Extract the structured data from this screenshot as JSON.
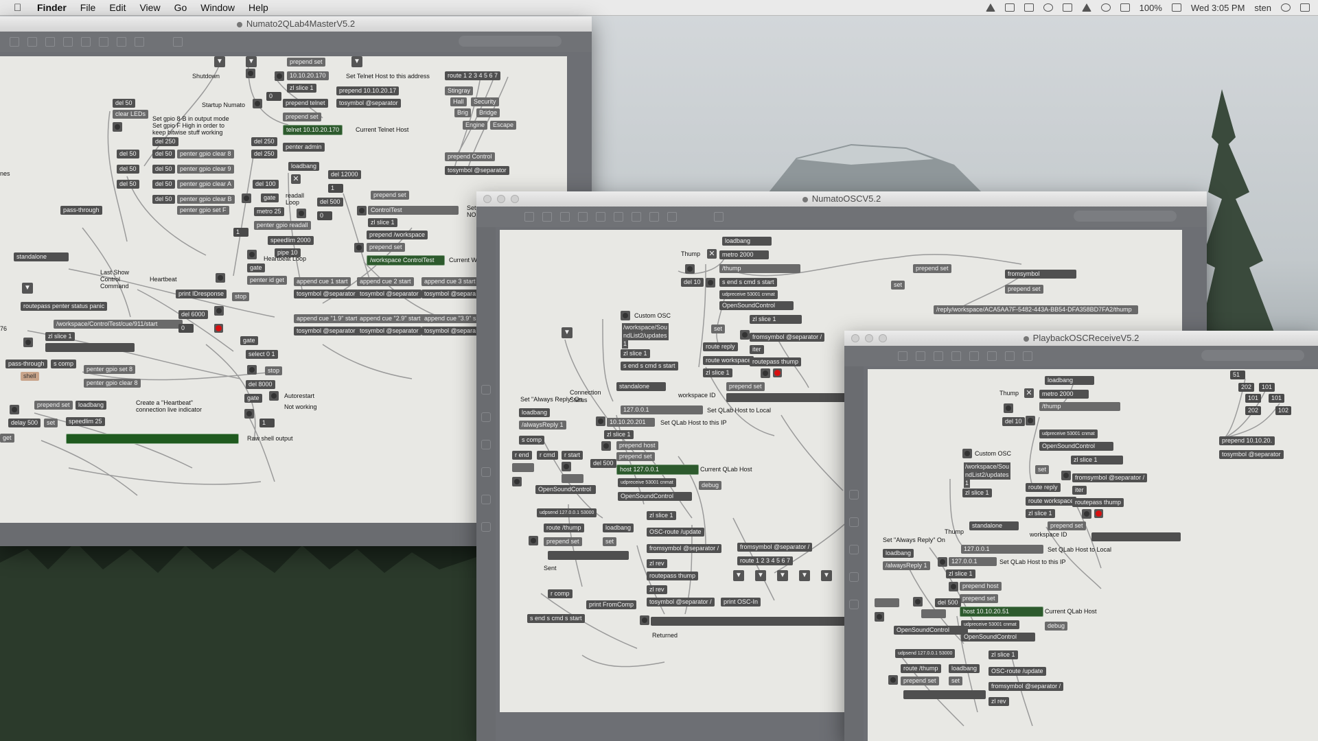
{
  "menubar": {
    "app": "Finder",
    "items": [
      "File",
      "Edit",
      "View",
      "Go",
      "Window",
      "Help"
    ],
    "battery": "100%",
    "clock": "Wed 3:05 PM",
    "user": "sten",
    "status_icons": [
      "cloud-icon",
      "dropbox-icon",
      "display-icon",
      "notification-icon",
      "bluetooth-icon",
      "volume-icon",
      "wifi-icon",
      "keyboard-icon",
      "battery-icon",
      "search-icon",
      "menu-icon"
    ]
  },
  "window1": {
    "title": "Numato2QLab4MasterV5.2",
    "objects": {
      "prepend_set_top": "prepend set",
      "ip_170": "10.10.20.170",
      "set_telnet_comment": "Set Telnet Host to this address",
      "route_1_7": "route 1 2 3 4 5 6 7",
      "shutdown": "Shutdown",
      "zl_slice_1": "zl slice 1",
      "prepend_ip_17": "prepend 10.10.20.17",
      "stingray": "Stingray",
      "del_50": "del 50",
      "startup_numato": "Startup Numato",
      "prepend_telnet": "prepend telnet",
      "tosymbol_sep": "tosymbol @separator",
      "hall": "Hall",
      "security": "Security",
      "clear_leds": "clear LEDs",
      "brig": "Brig",
      "bridge": "Bridge",
      "gpio_comment_1": "Set gpio 8-B in output mode",
      "gpio_comment_2": "Set gpio F High in order to",
      "gpio_comment_3": "keep bitwise stuff working",
      "prepend_set_2": "prepend set",
      "engine": "Engine",
      "escape": "Escape",
      "telnet_170": "telnet 10.10.20.170",
      "current_telnet_host": "Current Telnet Host",
      "del_250": "del 250",
      "penter_gpio_clear_8": "penter gpio clear 8",
      "penter_gpio_clear_9": "penter gpio clear 9",
      "penter_gpio_clear_a": "penter gpio clear A",
      "penter_gpio_clear_b": "penter gpio clear B",
      "penter_gpio_set_f": "penter gpio set F",
      "penter_admin": "penter admin",
      "prepend_control": "prepend Control",
      "tosymbol_sep_2": "tosymbol @separator",
      "loadbang": "loadbang",
      "del_12000": "del 12000",
      "del_100": "del 100",
      "gate": "gate",
      "readall_loop": "readall",
      "loop": "Loop",
      "metro_25": "metro 25",
      "del_500": "del 500",
      "control_test": "ControlTest",
      "pass_through": "pass-through",
      "penter_gpio_readall": "penter gpio readall",
      "speedlim_2000": "speedlim 2000",
      "prepend_workspace": "prepend /workspace",
      "pipe_10": "pipe 10",
      "heartbeat_loop": "Heartbeat Loop",
      "workspace_controltest": "/workspace ControlTest",
      "current_w": "Current W",
      "standalone": "standalone",
      "penter_id_get": "penter id get",
      "append_cue_1": "append cue 1 start",
      "append_cue_2": "append cue 2 start",
      "append_cue_3": "append cue 3 start",
      "last_show_1": "Last Show",
      "last_show_2": "Control",
      "last_show_3": "Command",
      "heartbeat": "Heartbeat",
      "print_idresponse": "print IDresponse",
      "stop": "stop",
      "tosymbol_a": "tosymbol @separator",
      "tosymbol_b": "tosymbol @separator",
      "tosymbol_c": "tosymbol @separa",
      "routepass_penter": "routepass penter status panic",
      "del_6000": "del 6000",
      "append_cue_19": "append cue \"1.9\" start",
      "append_cue_29": "append cue \"2.9\" start",
      "append_cue_39": "append cue \"3.9\" s",
      "workspace_cue_path": "/workspace/ControlTest/cue/911/start",
      "zl_slice_1b": "zl slice 1",
      "select_0_1": "select 0 1",
      "pass_through_2": "pass-through",
      "s_comp": "s comp",
      "penter_gpio_set_8": "penter gpio set 8",
      "shell": "shell",
      "penter_gpio_clear_8b": "penter gpio clear 8",
      "del_8000": "del 8000",
      "autorestart": "Autorestart",
      "not_working": "Not working",
      "prepend_set_3": "prepend set",
      "loadbang_2": "loadbang",
      "heartbeat_comment_1": "Create a \"Heartbeat\"",
      "heartbeat_comment_2": "connection live indicator",
      "delay_500": "delay 500",
      "set": "set",
      "speedlim_25": "speedlim 25",
      "raw_shell_output": "Raw shell output",
      "get": "get",
      "nes": "nes",
      "n76": "76",
      "n0": "0",
      "n1": "1",
      "x": "✕",
      "sn": "Set",
      "no": "NO"
    }
  },
  "window2": {
    "title": "NumatoOSCV5.2",
    "objects": {
      "loadbang": "loadbang",
      "thump": "Thump",
      "metro_2000": "metro 2000",
      "thump_path": "/thump",
      "prepend_set": "prepend set",
      "fromsymbol": "fromsymbol",
      "del_10": "del 10",
      "s_end_cmd_start": "s end  s cmd  s start",
      "set": "set",
      "prepend_set_2": "prepend set",
      "udpreceive": "udpreceive 53001 cnmat",
      "custom_osc": "Custom OSC",
      "open_sound_control": "OpenSoundControl",
      "reply_path": "/reply/workspace/ACA5AA7F-5482-443A-BB54-DFA358BD7FA2/thump",
      "workspace_path_1": "/workspace/Sou",
      "workspace_path_2": "ndList2/updates",
      "workspace_path_3": "1",
      "zl_slice_1": "zl slice 1",
      "set_2": "set",
      "fromsymbol_sep": "fromsymbol @separator /",
      "route_reply": "route reply",
      "iter": "iter",
      "route_workspace": "route workspace",
      "routepass_thump": "routepass thump",
      "zl_slice_1b": "zl slice 1",
      "standalone": "standalone",
      "prepend_set_3": "prepend set",
      "set_always_reply": "Set \"Always Reply\" On",
      "connection_status": "Connection Status",
      "workspace_id": "workspace ID",
      "loadbang_2": "loadbang",
      "localhost": "127.0.0.1",
      "set_qlab_local": "Set QLab Host to Local",
      "always_reply": "/alwaysReply 1",
      "ip_201": "10.10.20.201",
      "set_qlab_ip": "Set QLab Host to this IP",
      "zl_slice_1c": "zl slice 1",
      "s_comp": "s comp",
      "prepend_host": "prepend host",
      "r_end": "r end",
      "r_cmd": "r cmd",
      "r_start": "r start",
      "prepend_set_4": "prepend set",
      "del_500": "del 500",
      "host_local": "host 127.0.0.1",
      "current_qlab_host": "Current QLab Host",
      "udpreceive_2": "udpreceive 53001 cnmat",
      "open_sound_control_2": "OpenSoundControl",
      "open_sound_control_3": "OpenSoundControl",
      "debug": "debug",
      "udpsend": "udpsend 127.0.0.1 53000",
      "zl_slice_1d": "zl slice 1",
      "route_thump": "route /thump",
      "loadbang_3": "loadbang",
      "osc_route_update": "OSC-route /update",
      "prepend_set_5": "prepend set",
      "set_3": "set",
      "fromsymbol_sep_2": "fromsymbol @separator /",
      "fromsymbol_sep_3": "fromsymbol @separator /",
      "zl_rev": "zl rev",
      "route_1_7": "route 1 2 3 4 5 6 7",
      "sent": "Sent",
      "routepass_thump_2": "routepass thump",
      "zl_rev_2": "zl rev",
      "r_comp": "r comp",
      "tosymbol_sep": "tosymbol @separator /",
      "print_osc_in": "print OSC-In",
      "print_from_comp": "print FromComp",
      "s_end_2": "s end  s cmd  s start",
      "returned": "Returned",
      "x": "✕",
      "down": "▼"
    }
  },
  "window3": {
    "title": "PlaybackOSCReceiveV5.2",
    "objects": {
      "loadbang": "loadbang",
      "n51": "51",
      "n202": "202",
      "n101": "101",
      "n101b": "101",
      "n101c": "101",
      "n202b": "202",
      "n102": "102",
      "thump": "Thump",
      "metro_2000": "metro 2000",
      "thump_path": "/thump",
      "del_10": "del 10",
      "udpreceive": "udpreceive 53001 cnmat",
      "prepend_ip": "prepend 10.10.20.",
      "open_sound_control": "OpenSoundControl",
      "tosymbol_sep": "tosymbol @separator",
      "custom_osc": "Custom OSC",
      "zl_slice_1": "zl slice 1",
      "workspace_path_1": "/workspace/Sou",
      "workspace_path_2": "ndList2/updates",
      "workspace_path_3": "1",
      "set": "set",
      "fromsymbol_sep": "fromsymbol @separator /",
      "route_reply": "route reply",
      "iter": "iter",
      "zl_slice_1b": "zl slice 1",
      "route_workspace": "route workspace",
      "routepass_thump": "routepass thump",
      "zl_slice_1c": "zl slice 1",
      "standalone": "standalone",
      "prepend_set": "prepend set",
      "thump_2": "Thump",
      "set_always_reply": "Set \"Always Reply\" On",
      "workspace_id": "workspace ID",
      "localhost": "127.0.0.1",
      "set_qlab_local": "Set QLab Host to Local",
      "loadbang_2": "loadbang",
      "always_reply": "/alwaysReply 1",
      "localhost_2": "127.0.0.1",
      "set_qlab_ip": "Set QLab Host to this IP",
      "zl_slice_1d": "zl slice 1",
      "prepend_host": "prepend host",
      "prepend_set_2": "prepend set",
      "del_500": "del 500",
      "host_51": "host 10.10.20.51",
      "current_qlab_host": "Current QLab Host",
      "udpreceive_2": "udpreceive 53001 cnmat",
      "open_sound_control_2": "OpenSoundControl",
      "debug": "debug",
      "open_sound_control_3": "OpenSoundControl",
      "zl_slice_1e": "zl slice 1",
      "udpsend": "udpsend 127.0.0.1 53000",
      "route_thump": "route /thump",
      "loadbang_3": "loadbang",
      "osc_route_update": "OSC-route /update",
      "prepend_set_3": "prepend set",
      "set_2": "set",
      "fromsymbol_sep_2": "fromsymbol @separator /",
      "zl_rev": "zl rev",
      "x": "✕"
    }
  }
}
